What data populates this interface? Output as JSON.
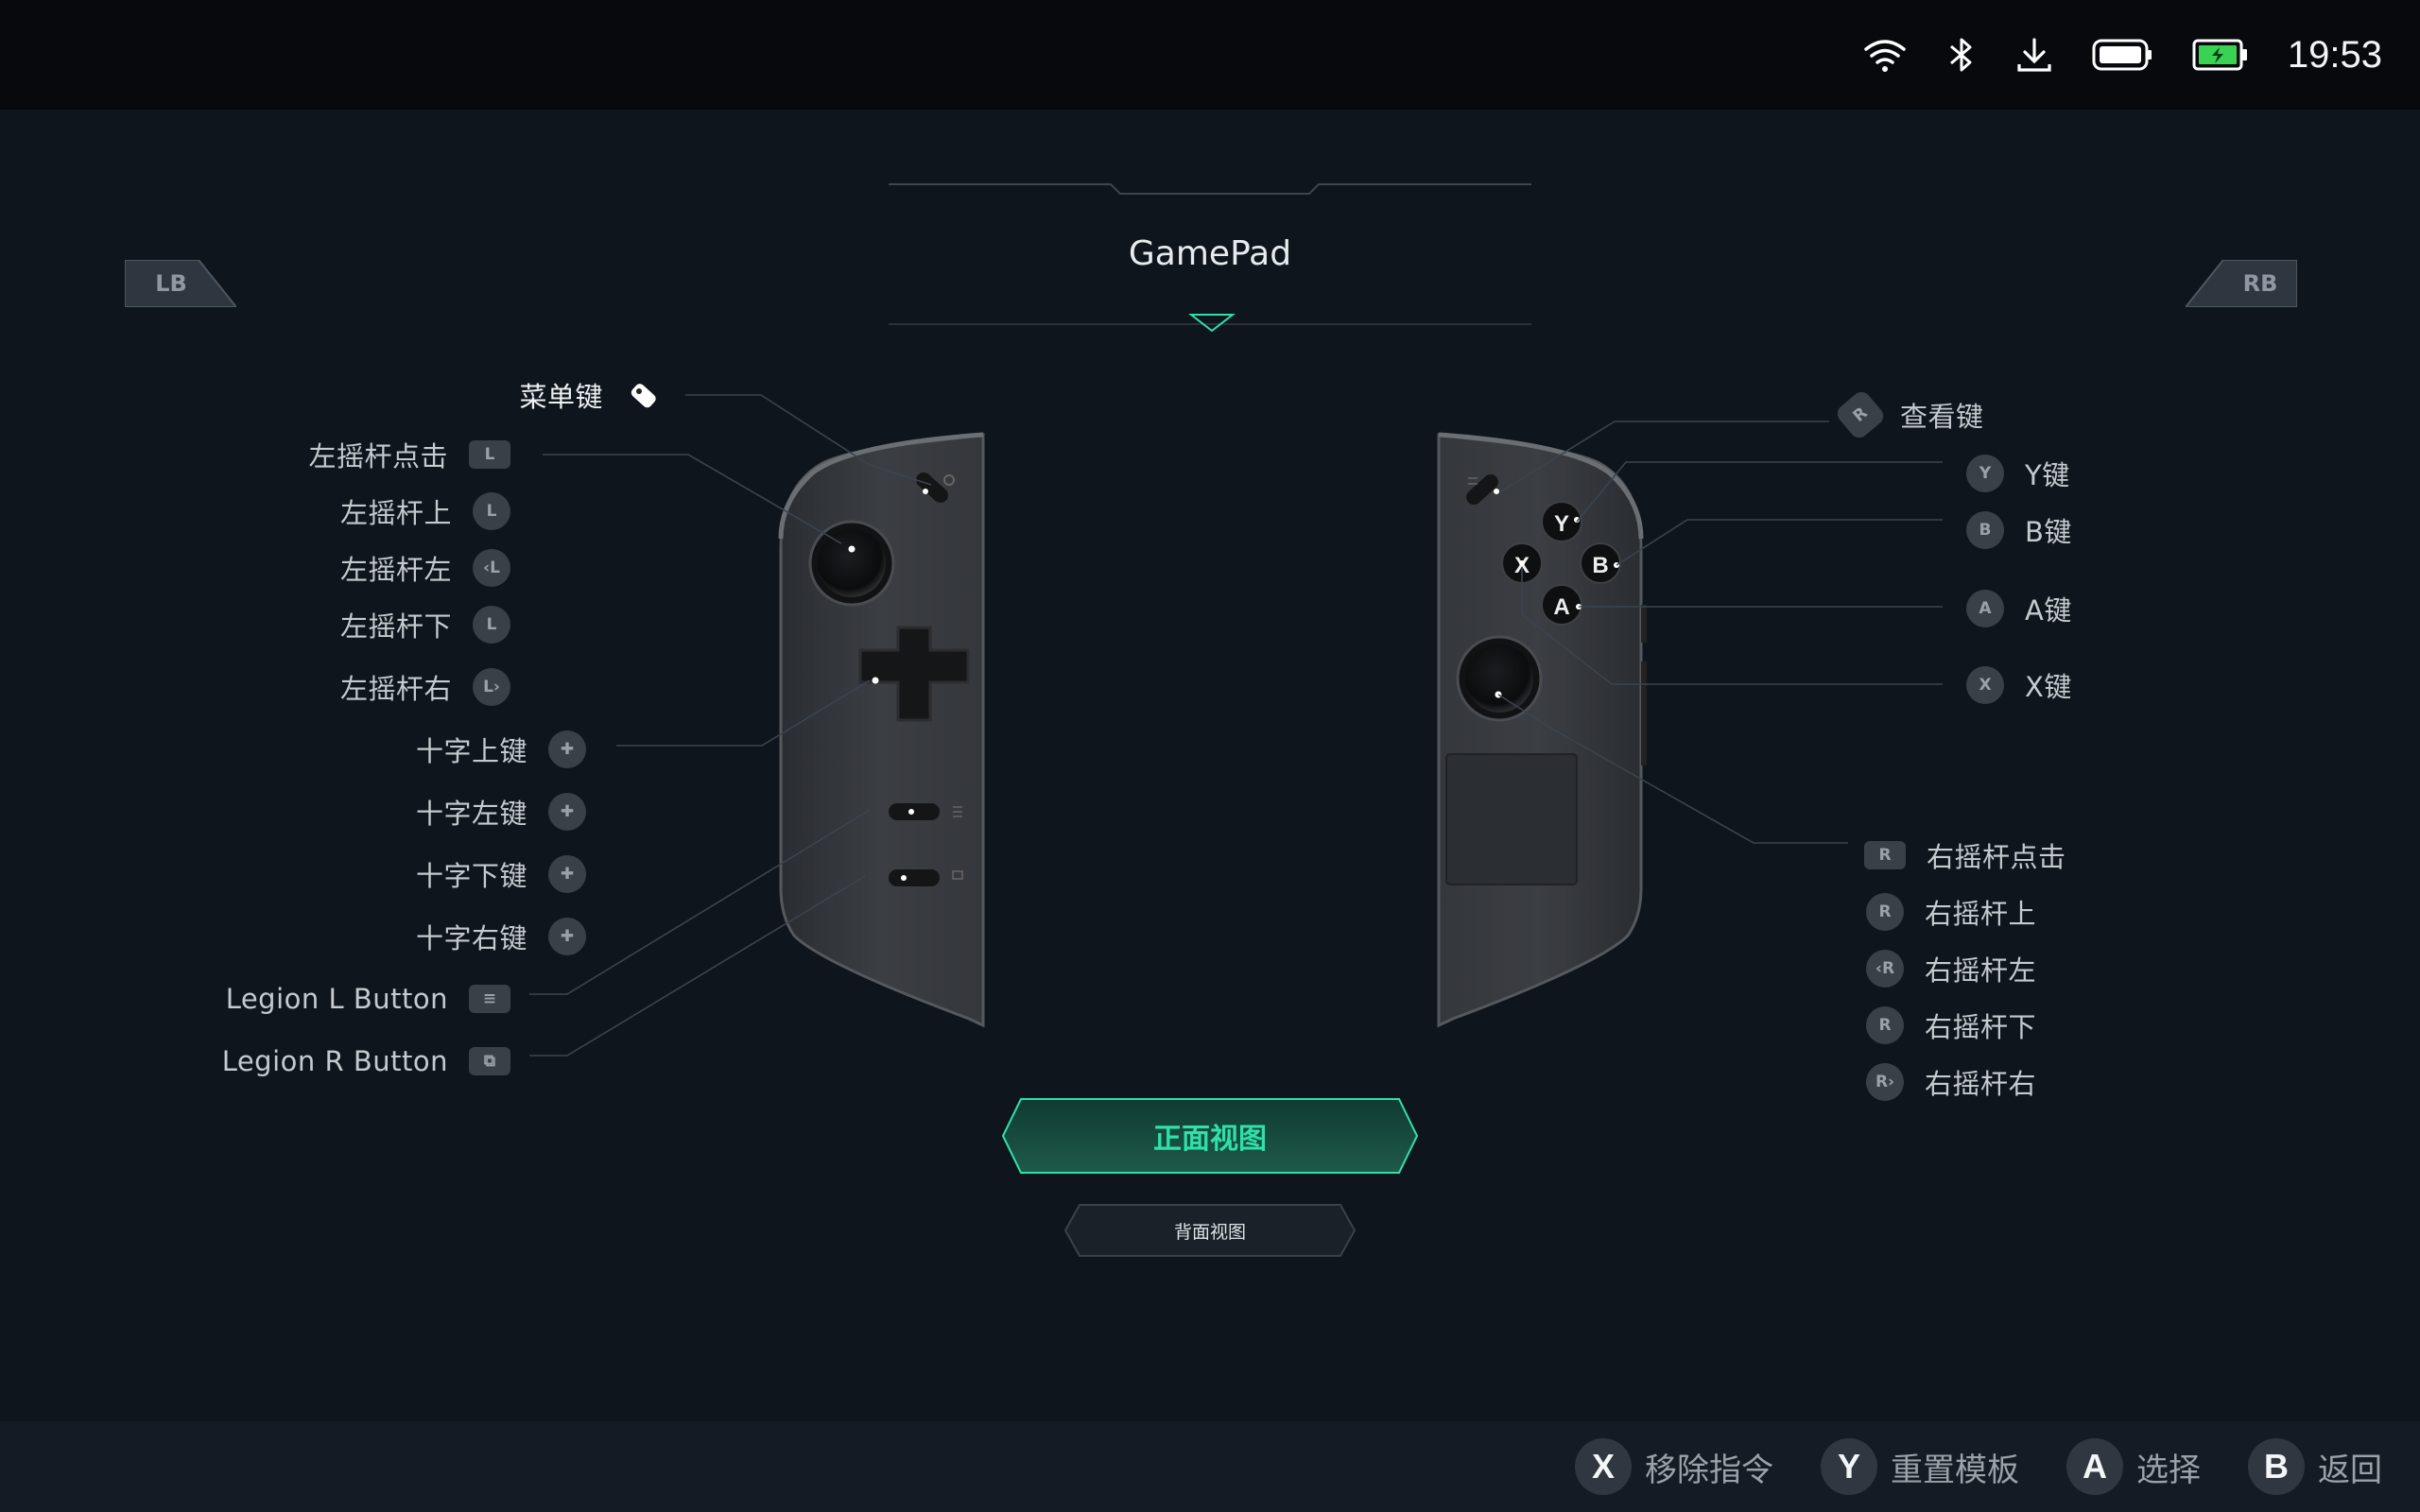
{
  "status_bar": {
    "time": "19:53",
    "icons": [
      "wifi-icon",
      "bluetooth-icon",
      "download-icon",
      "controller-battery-icon",
      "battery-charging-icon"
    ],
    "battery_color": "#39d353"
  },
  "header": {
    "title": "GamePad",
    "lb_label": "LB",
    "rb_label": "RB"
  },
  "left_labels": [
    {
      "text": "菜单键",
      "icon": "menu-key-icon",
      "glyph": ""
    },
    {
      "text": "左摇杆点击",
      "icon": "left-stick-click-icon",
      "glyph": "L"
    },
    {
      "text": "左摇杆上",
      "icon": "left-stick-up-icon",
      "glyph": "L"
    },
    {
      "text": "左摇杆左",
      "icon": "left-stick-left-icon",
      "glyph": "‹L"
    },
    {
      "text": "左摇杆下",
      "icon": "left-stick-down-icon",
      "glyph": "L"
    },
    {
      "text": "左摇杆右",
      "icon": "left-stick-right-icon",
      "glyph": "L›"
    },
    {
      "text": "十字上键",
      "icon": "dpad-up-icon",
      "glyph": "✚"
    },
    {
      "text": "十字左键",
      "icon": "dpad-left-icon",
      "glyph": "✚"
    },
    {
      "text": "十字下键",
      "icon": "dpad-down-icon",
      "glyph": "✚"
    },
    {
      "text": "十字右键",
      "icon": "dpad-right-icon",
      "glyph": "✚"
    },
    {
      "text": "Legion L Button",
      "icon": "legion-l-button-icon",
      "glyph": "≡"
    },
    {
      "text": "Legion R Button",
      "icon": "legion-r-button-icon",
      "glyph": "⧉"
    }
  ],
  "right_labels": [
    {
      "text": "查看键",
      "icon": "view-key-icon",
      "glyph": "R"
    },
    {
      "text": "Y键",
      "icon": "y-button-icon",
      "glyph": "Y"
    },
    {
      "text": "B键",
      "icon": "b-button-icon",
      "glyph": "B"
    },
    {
      "text": "A键",
      "icon": "a-button-icon",
      "glyph": "A"
    },
    {
      "text": "X键",
      "icon": "x-button-icon",
      "glyph": "X"
    },
    {
      "text": "右摇杆点击",
      "icon": "right-stick-click-icon",
      "glyph": "R"
    },
    {
      "text": "右摇杆上",
      "icon": "right-stick-up-icon",
      "glyph": "R"
    },
    {
      "text": "右摇杆左",
      "icon": "right-stick-left-icon",
      "glyph": "‹R"
    },
    {
      "text": "右摇杆下",
      "icon": "right-stick-down-icon",
      "glyph": "R"
    },
    {
      "text": "右摇杆右",
      "icon": "right-stick-right-icon",
      "glyph": "R›"
    }
  ],
  "controller_buttons": {
    "y": "Y",
    "x": "X",
    "b": "B",
    "a": "A"
  },
  "view_buttons": {
    "front": "正面视图",
    "back": "背面视图",
    "accent": "#2fe0a8"
  },
  "bottom_hints": [
    {
      "key": "X",
      "label": "移除指令"
    },
    {
      "key": "Y",
      "label": "重置模板"
    },
    {
      "key": "A",
      "label": "选择"
    },
    {
      "key": "B",
      "label": "返回"
    }
  ]
}
